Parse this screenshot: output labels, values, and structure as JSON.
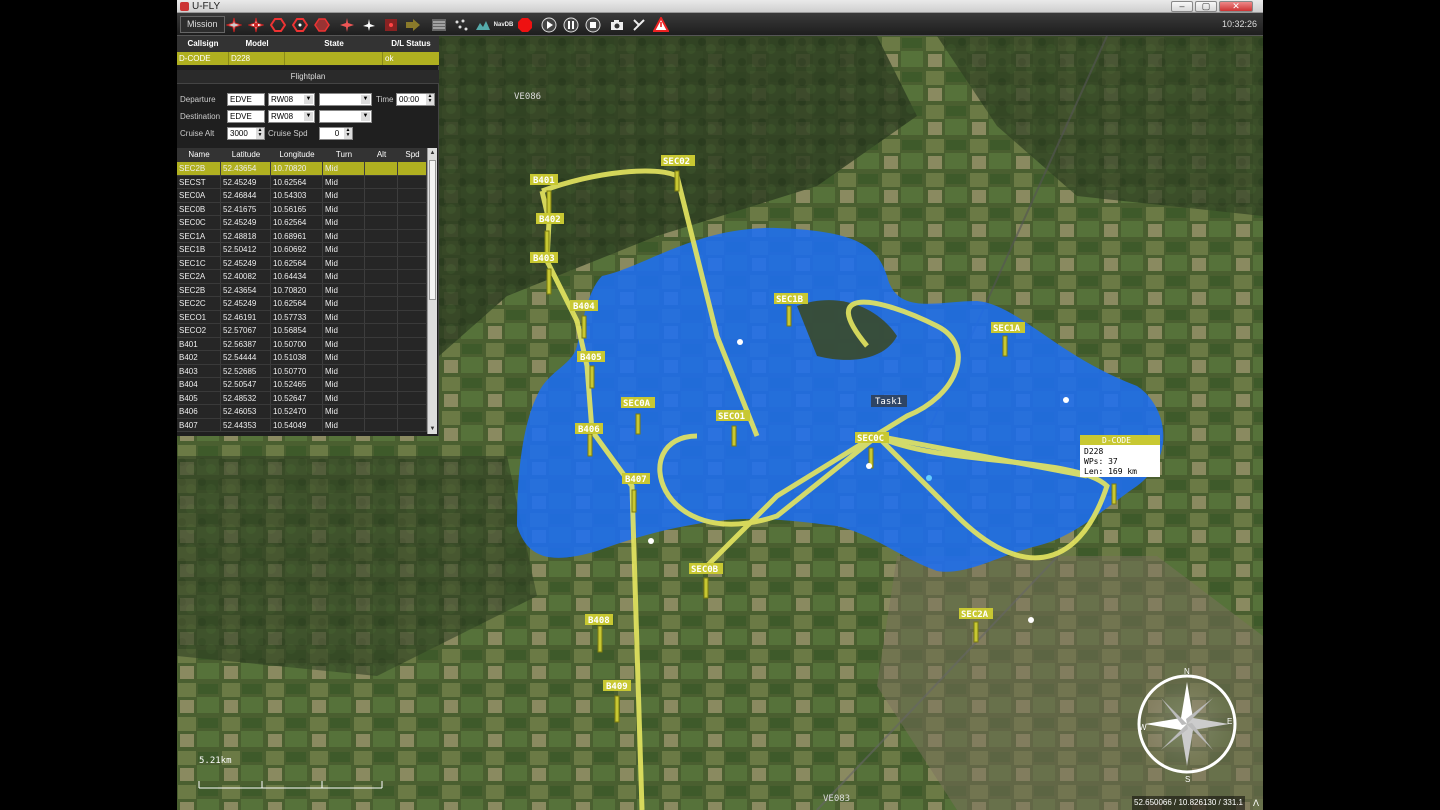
{
  "window": {
    "title": "U-FLY",
    "minimize": "–",
    "maximize": "▢",
    "close": "✕"
  },
  "toolbar": {
    "mission_label": "Mission",
    "navdb_label": "NavDB",
    "clock": "10:32:26"
  },
  "vehicle_table": {
    "headers": [
      "Callsign",
      "Model",
      "State",
      "D/L Status"
    ],
    "row": [
      "D-CODE",
      "D228",
      "",
      "ok"
    ]
  },
  "flightplan": {
    "title": "Flightplan",
    "departure_label": "Departure",
    "departure_value": "EDVE",
    "departure_runway": "RW08",
    "time_label": "Time",
    "time_value": "00:00",
    "destination_label": "Destination",
    "destination_value": "EDVE",
    "destination_runway": "RW08",
    "cruise_alt_label": "Cruise Alt",
    "cruise_alt_value": "3000",
    "cruise_spd_label": "Cruise Spd",
    "cruise_spd_value": "0"
  },
  "waypoints": {
    "headers": [
      "Name",
      "Latitude",
      "Longitude",
      "Turn",
      "Alt",
      "Spd"
    ],
    "rows": [
      [
        "SEC2B",
        "52.43654",
        "10.70820",
        "Mid",
        "",
        ""
      ],
      [
        "SECST",
        "52.45249",
        "10.62564",
        "Mid",
        "",
        ""
      ],
      [
        "SEC0A",
        "52.46844",
        "10.54303",
        "Mid",
        "",
        ""
      ],
      [
        "SEC0B",
        "52.41675",
        "10.56165",
        "Mid",
        "",
        ""
      ],
      [
        "SEC0C",
        "52.45249",
        "10.62564",
        "Mid",
        "",
        ""
      ],
      [
        "SEC1A",
        "52.48818",
        "10.68961",
        "Mid",
        "",
        ""
      ],
      [
        "SEC1B",
        "52.50412",
        "10.60692",
        "Mid",
        "",
        ""
      ],
      [
        "SEC1C",
        "52.45249",
        "10.62564",
        "Mid",
        "",
        ""
      ],
      [
        "SEC2A",
        "52.40082",
        "10.64434",
        "Mid",
        "",
        ""
      ],
      [
        "SEC2B",
        "52.43654",
        "10.70820",
        "Mid",
        "",
        ""
      ],
      [
        "SEC2C",
        "52.45249",
        "10.62564",
        "Mid",
        "",
        ""
      ],
      [
        "SECO1",
        "52.46191",
        "10.57733",
        "Mid",
        "",
        ""
      ],
      [
        "SECO2",
        "52.57067",
        "10.56854",
        "Mid",
        "",
        ""
      ],
      [
        "B401",
        "52.56387",
        "10.50700",
        "Mid",
        "",
        ""
      ],
      [
        "B402",
        "52.54444",
        "10.51038",
        "Mid",
        "",
        ""
      ],
      [
        "B403",
        "52.52685",
        "10.50770",
        "Mid",
        "",
        ""
      ],
      [
        "B404",
        "52.50547",
        "10.52465",
        "Mid",
        "",
        ""
      ],
      [
        "B405",
        "52.48532",
        "10.52647",
        "Mid",
        "",
        ""
      ],
      [
        "B406",
        "52.46053",
        "10.52470",
        "Mid",
        "",
        ""
      ],
      [
        "B407",
        "52.44353",
        "10.54049",
        "Mid",
        "",
        ""
      ]
    ]
  },
  "map": {
    "labels": {
      "VE086": "VE086",
      "VE083": "VE083",
      "task": "Task1",
      "scale": "5.21km"
    },
    "waypoints": [
      "B401",
      "B402",
      "B403",
      "B404",
      "B405",
      "B406",
      "B407",
      "B408",
      "B409",
      "SEC02",
      "SEC1B",
      "SEC1A",
      "SEC0A",
      "SECO1",
      "SEC0C",
      "SEC0B",
      "SEC2A"
    ],
    "info_box": {
      "title": "D-CODE",
      "line1": "D228",
      "line2": "WPs: 37",
      "line3": "Len: 169 km"
    },
    "compass": {
      "n": "N",
      "e": "E",
      "s": "S",
      "w": "W"
    },
    "colors": {
      "airspace": "#1e6ef0",
      "route": "#e6e660",
      "label_bg": "#c8c832"
    }
  },
  "status": {
    "coords": "52.650066 / 10.826130 / 331.1",
    "expand": "Λ"
  }
}
